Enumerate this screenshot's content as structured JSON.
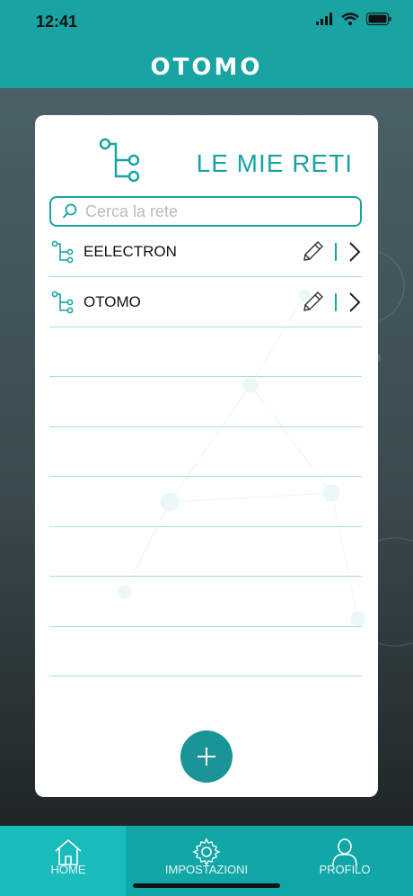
{
  "status": {
    "time": "12:41"
  },
  "brand": "OTOMO",
  "page": {
    "title": "LE MIE RETI"
  },
  "search": {
    "placeholder": "Cerca la rete",
    "value": ""
  },
  "networks": [
    {
      "name": "EELECTRON"
    },
    {
      "name": "OTOMO"
    }
  ],
  "tabs": [
    {
      "label": "HOME",
      "icon": "home-icon"
    },
    {
      "label": "IMPOSTAZIONI",
      "icon": "gear-icon"
    },
    {
      "label": "PROFILO",
      "icon": "user-icon"
    }
  ],
  "colors": {
    "accent": "#1aa3a3",
    "fab": "#1a9597",
    "tabbar": "#12a7a7"
  }
}
